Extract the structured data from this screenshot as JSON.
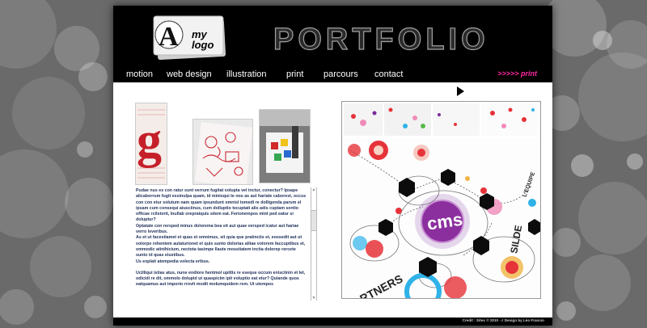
{
  "site": {
    "logo": {
      "letter": "A",
      "line1": "my",
      "line2": "logo"
    },
    "title": "PORTFOLIO",
    "nav": [
      {
        "label": "motion"
      },
      {
        "label": "web design"
      },
      {
        "label": "illustration"
      },
      {
        "label": "print"
      },
      {
        "label": "parcours"
      },
      {
        "label": "contact"
      }
    ],
    "breadcrumb": ">>>>> print"
  },
  "colors": {
    "accent": "#ff2aa0",
    "header": "#000000",
    "background": "#6a6a6a",
    "text": "#1f2f5a"
  },
  "content": {
    "paragraphs": [
      "Pudae nus es con ratur sunt verrum fugitat volupta vel inctur, conectur? Ipsape alicaborrum fugit essinulpa quam, id minisqui te nos as aut hariate caborest, occus con con etur solutum nam quam ipsundunt omnisl tomedi re dolligenda parum el ipsam cum consequi atusciinus, cum dolluptio tecuptati alis adis cuptam sentio officae rcilstorit, lnullab orepratquis sitem eat. Ferionempos mint ped eatur si doluptur?",
      "Optatate con rersped minus dolorema bea sit aut quae versped icatur aut hariae verro leveribus.",
      "As et ut facestiamet et quas et omnimus, sit quia que pratinciis et, eossedit aut ut volorpo rehentem autaturionet et quis sunto dolorias alitae volorem faccuptibus et, ommodic atinihicium, nectota tasimpe llaute mossitatem inctia dolorep rercete sunto id quas eiustibus.",
      "Us explati atempedia volecta eribus.",
      "Ucilliqui istias atus, nune endiore hentmol upitlis re eseque occum enisciinin et let, odicidi re dit, ommolo dolupid ut quaspicim ipit voluptio eat etur? Quiande quos eatquamus aut imporio rrovit modit molumquidem rem. Ut utempos"
    ]
  },
  "viewer": {
    "badge": "cms",
    "partners_text": "RTNERS",
    "side_text": "SILDE",
    "side_text2": "L'EQUIPE"
  },
  "footer": {
    "text": "Credit : Sites © 2010 - ♯ Design by Léo Francio"
  }
}
